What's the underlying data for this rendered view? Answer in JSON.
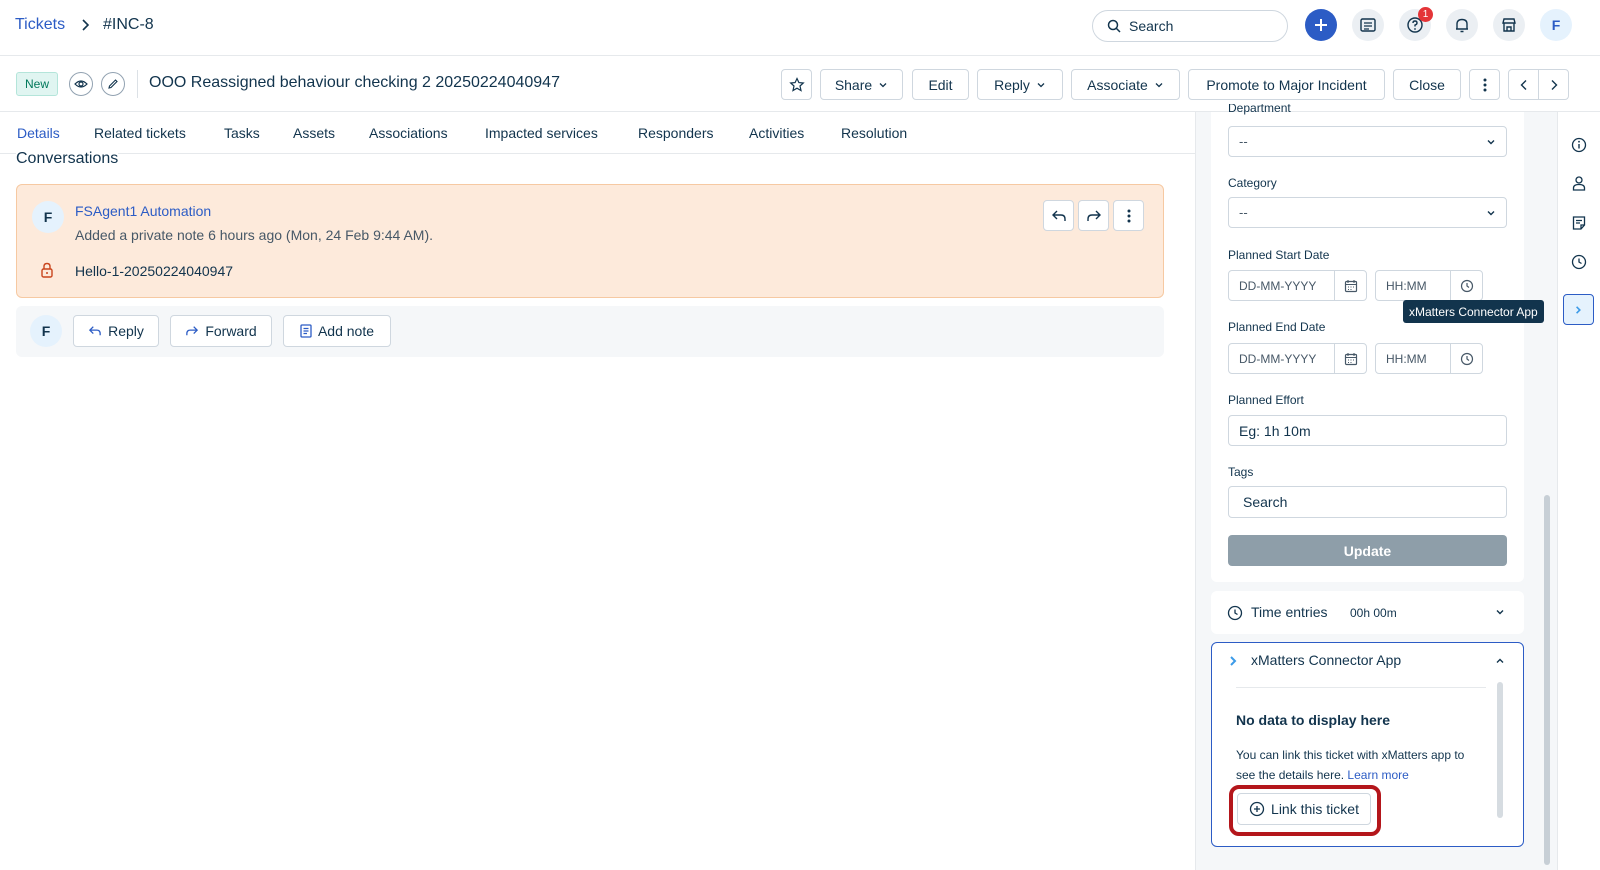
{
  "breadcrumb": {
    "root": "Tickets",
    "current": "#INC-8"
  },
  "topbar": {
    "search_placeholder": "Search",
    "help_badge": "1",
    "avatar_initial": "F"
  },
  "ticket": {
    "status": "New",
    "title": "OOO Reassigned behaviour checking 2 20250224040947"
  },
  "toolbar": {
    "share": "Share",
    "edit": "Edit",
    "reply": "Reply",
    "associate": "Associate",
    "promote": "Promote to Major Incident",
    "close": "Close"
  },
  "tabs": [
    "Details",
    "Related tickets",
    "Tasks",
    "Assets",
    "Associations",
    "Impacted services",
    "Responders",
    "Activities",
    "Resolution"
  ],
  "conversations": {
    "heading": "Conversations",
    "note": {
      "avatar": "F",
      "author": "FSAgent1 Automation",
      "meta": "Added a private note 6 hours ago (Mon, 24 Feb 9:44 AM).",
      "body": "Hello-1-20250224040947"
    },
    "reply_bar": {
      "avatar": "F",
      "reply": "Reply",
      "forward": "Forward",
      "add_note": "Add note"
    }
  },
  "properties": {
    "department_label": "Department",
    "department_value": "--",
    "category_label": "Category",
    "category_value": "--",
    "planned_start_label": "Planned Start Date",
    "planned_end_label": "Planned End Date",
    "date_placeholder": "DD-MM-YYYY",
    "time_placeholder": "HH:MM",
    "planned_effort_label": "Planned Effort",
    "planned_effort_placeholder": "Eg: 1h 10m",
    "tags_label": "Tags",
    "tags_placeholder": "Search",
    "update": "Update"
  },
  "time_entries": {
    "label": "Time entries",
    "value": "00h 00m"
  },
  "xmatters": {
    "title": "xMatters Connector App",
    "empty_title": "No data to display here",
    "empty_text": "You can link this ticket with xMatters app to see the details here.",
    "learn_more": "Learn more",
    "link_button": "Link this ticket"
  },
  "tooltip": "xMatters Connector App",
  "colors": {
    "accent": "#2c5cc5",
    "note_bg": "#fdeadb",
    "note_border": "#f6c9a2",
    "update_bg": "#8e9ea9",
    "highlight": "#b4161b",
    "badge_red": "#e43538"
  }
}
